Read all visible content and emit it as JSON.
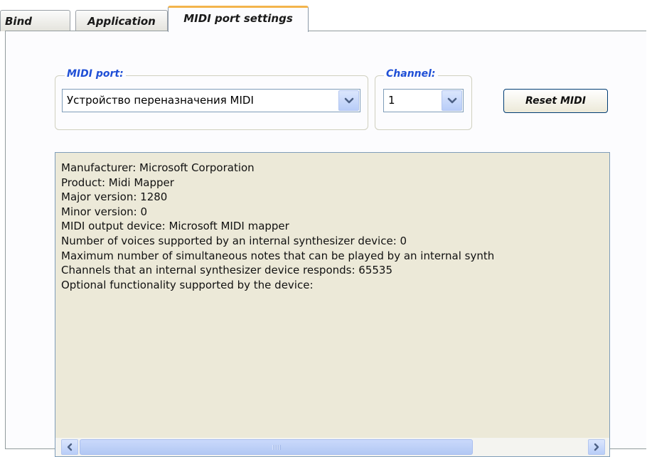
{
  "tabs": [
    {
      "label": "Bind"
    },
    {
      "label": "Application"
    },
    {
      "label": "MIDI port settings",
      "active": true
    }
  ],
  "midi_port": {
    "legend": "MIDI port:",
    "value": "Устройство переназначения MIDI"
  },
  "channel": {
    "legend": "Channel:",
    "value": "1"
  },
  "reset_button": {
    "label": "Reset MIDI"
  },
  "device_info": {
    "lines": [
      "Manufacturer: Microsoft Corporation",
      "Product: Midi Mapper",
      "Major version: 1280",
      "Minor version: 0",
      "MIDI output device: Microsoft MIDI mapper",
      "Number of voices supported by an internal synthesizer device: 0",
      "Maximum number of simultaneous notes that can be played by an internal synth",
      "Channels that an internal synthesizer device responds: 65535",
      "Optional functionality supported by the device:"
    ]
  },
  "colors": {
    "legend_text": "#1f4fd6",
    "active_tab_accent": "#f3b44c",
    "info_background": "#ece9d8",
    "control_border": "#7f9db9"
  },
  "icons": {
    "dropdown": "chevron-down-icon",
    "scroll_left": "arrow-left-icon",
    "scroll_right": "arrow-right-icon",
    "scroll_grip": "grip-icon"
  }
}
